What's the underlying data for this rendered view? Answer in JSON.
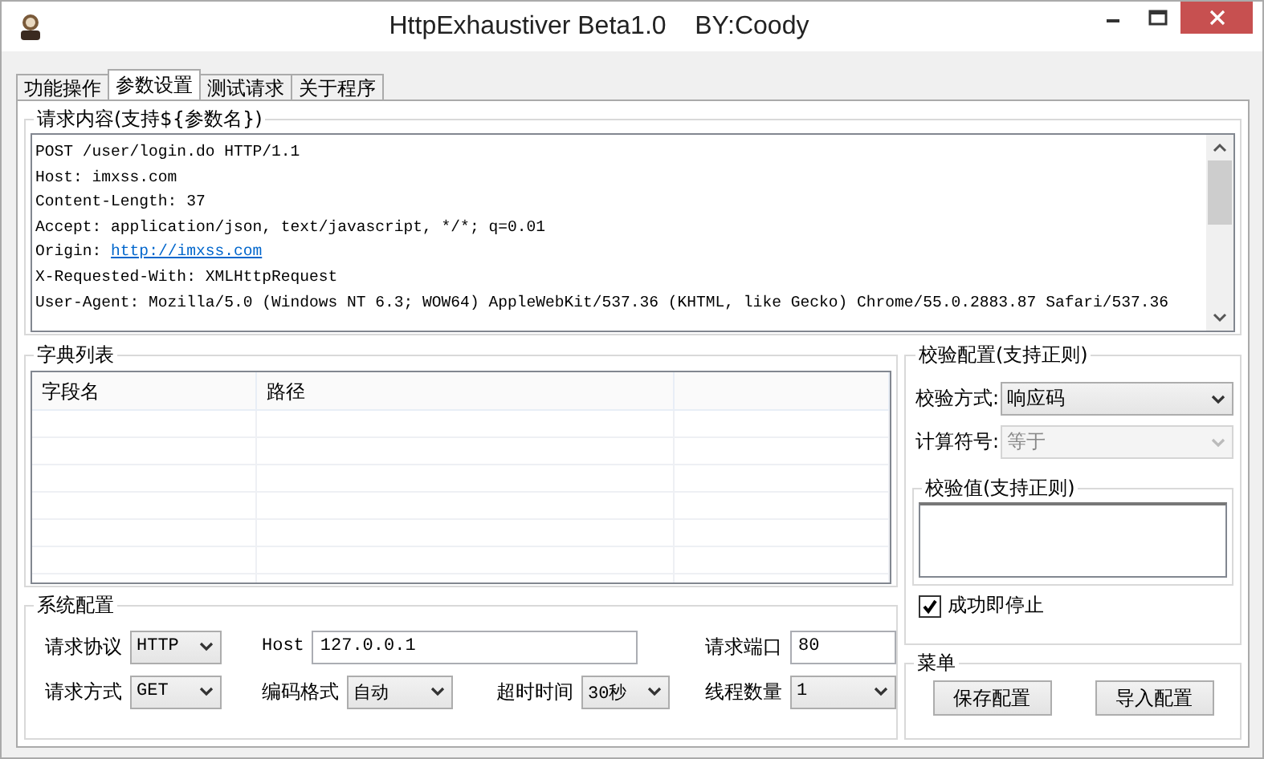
{
  "window": {
    "title": "HttpExhaustiver Beta1.0    BY:Coody"
  },
  "tabs": [
    {
      "label": "功能操作",
      "selected": false
    },
    {
      "label": "参数设置",
      "selected": true
    },
    {
      "label": "测试请求",
      "selected": false
    },
    {
      "label": "关于程序",
      "selected": false
    }
  ],
  "request": {
    "title": "请求内容(支持${参数名})",
    "lines": [
      {
        "kind": "text",
        "text": "POST /user/login.do HTTP/1.1"
      },
      {
        "kind": "text",
        "text": "Host: imxss.com"
      },
      {
        "kind": "text",
        "text": "Content-Length: 37"
      },
      {
        "kind": "text",
        "text": "Accept: application/json, text/javascript, */*; q=0.01"
      },
      {
        "kind": "link",
        "text": "Origin: ",
        "link": "http://imxss.com"
      },
      {
        "kind": "text",
        "text": "X-Requested-With: XMLHttpRequest"
      },
      {
        "kind": "text",
        "text": "User-Agent: Mozilla/5.0 (Windows NT 6.3; WOW64) AppleWebKit/537.36 (KHTML, like Gecko) Chrome/55.0.2883.87 Safari/537.36"
      }
    ]
  },
  "dictionary": {
    "title": "字典列表",
    "columns": [
      "字段名",
      "路径"
    ]
  },
  "validation": {
    "title": "校验配置(支持正则)",
    "fields": [
      {
        "label": "校验方式:",
        "value": "响应码",
        "disabled": false
      },
      {
        "label": "计算符号:",
        "value": "等于",
        "disabled": true
      }
    ],
    "value_group": {
      "title": "校验值(支持正则)"
    },
    "stop_on_success": {
      "label": "成功即停止",
      "checked": true
    }
  },
  "system": {
    "title": "系统配置",
    "rows": [
      [
        {
          "label": "请求协议",
          "kind": "dropdown",
          "value": "HTTP"
        },
        {
          "label": "Host",
          "kind": "input",
          "value": "127.0.0.1"
        },
        "",
        {
          "label": "请求端口",
          "kind": "input",
          "value": "80"
        }
      ],
      [
        {
          "label": "请求方式",
          "kind": "dropdown",
          "value": "GET"
        },
        {
          "label": "编码格式",
          "kind": "dropdown",
          "value": "自动"
        },
        {
          "label": "超时时间",
          "kind": "dropdown",
          "value": "30秒"
        },
        {
          "label": "线程数量",
          "kind": "dropdown",
          "value": "1"
        }
      ]
    ]
  },
  "menu": {
    "title": "菜单",
    "buttons": [
      "保存配置",
      "导入配置"
    ]
  }
}
